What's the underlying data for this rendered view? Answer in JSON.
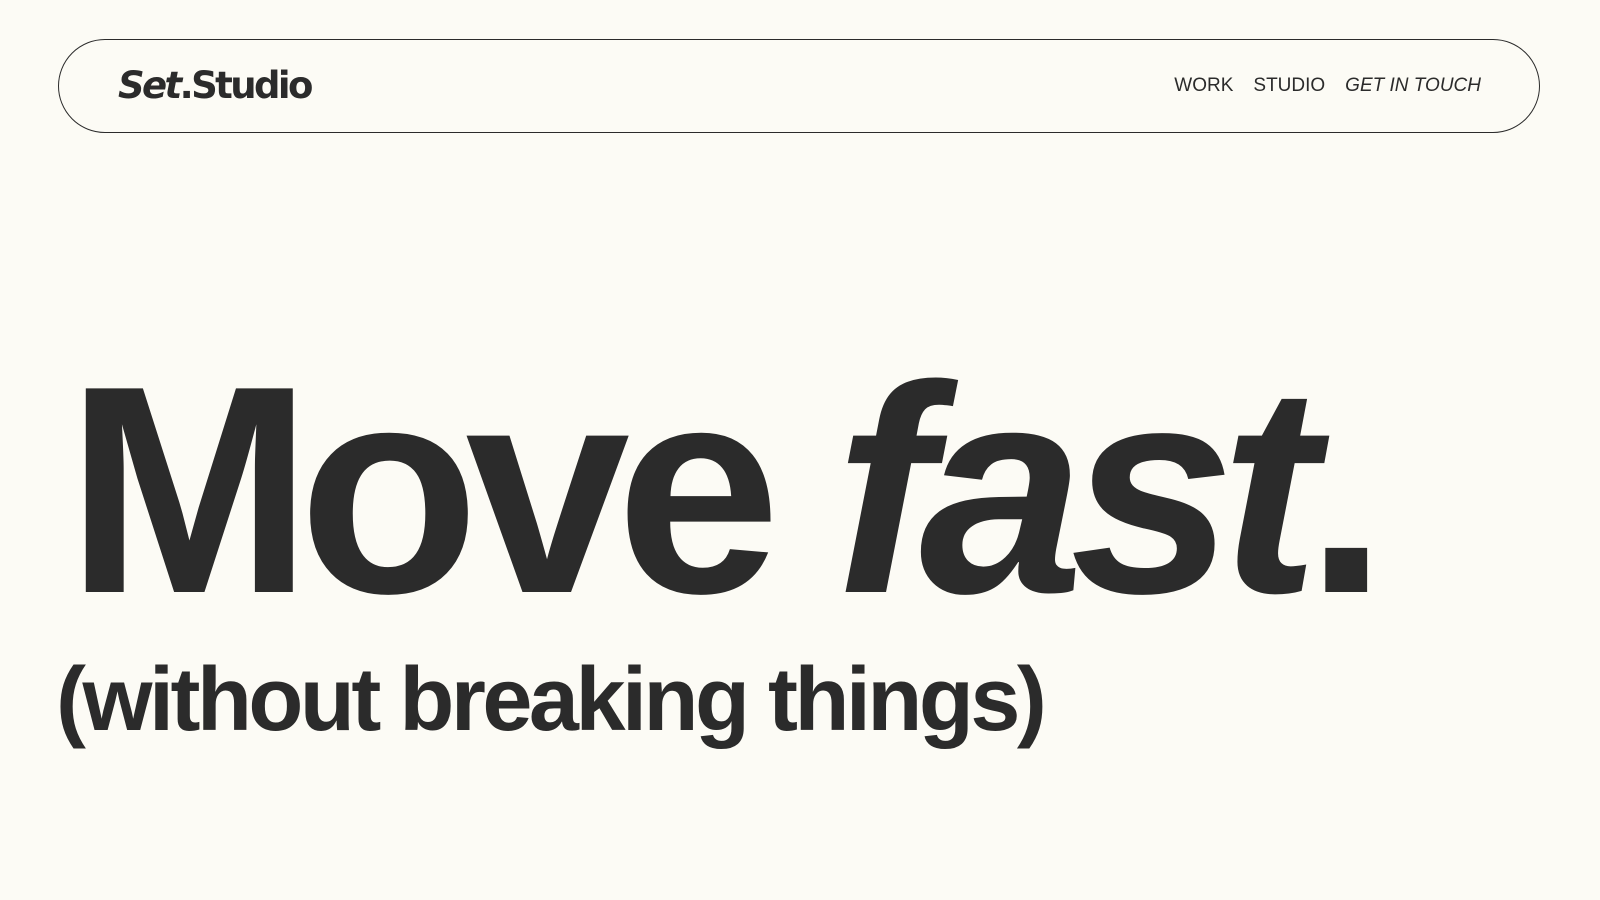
{
  "header": {
    "logo": {
      "part1": "Set",
      "part2": ".Studio"
    },
    "nav": {
      "work": "WORK",
      "studio": "STUDIO",
      "contact": "GET IN TOUCH"
    }
  },
  "hero": {
    "heading_regular": "Move ",
    "heading_italic": "fast",
    "heading_end": ".",
    "subheading": "(without breaking things)"
  },
  "colors": {
    "background": "#fcfbf5",
    "text": "#2b2b2b"
  }
}
